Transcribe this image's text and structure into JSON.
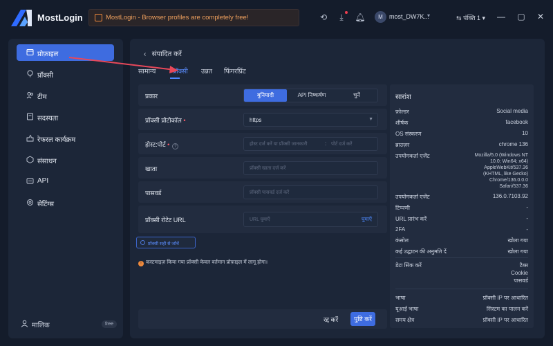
{
  "titlebar": {
    "app_name": "MostLogin",
    "banner_text": "MostLogin - Browser profiles are completely free!",
    "user_initial": "M",
    "user_name": "most_DW7K...",
    "language": "पंक्ति 1",
    "icons": [
      "refresh-icon",
      "download-icon",
      "bell-icon",
      "minimize-icon",
      "maximize-icon",
      "close-icon"
    ]
  },
  "sidebar": {
    "items": [
      {
        "label": "प्रोफ़ाइल",
        "icon": "profile-icon",
        "active": true
      },
      {
        "label": "प्रॉक्सी",
        "icon": "proxy-icon"
      },
      {
        "label": "टीम",
        "icon": "team-icon"
      },
      {
        "label": "सदस्यता",
        "icon": "subscription-icon"
      },
      {
        "label": "रेफरल कार्यक्रम",
        "icon": "referral-icon"
      },
      {
        "label": "संसाधन",
        "icon": "resources-icon"
      },
      {
        "label": "API",
        "icon": "api-icon"
      },
      {
        "label": "सेटिंग्स",
        "icon": "settings-icon"
      }
    ],
    "owner_label": "मालिक",
    "free_badge": "free"
  },
  "main": {
    "back_label": "संपादित करें",
    "tabs": [
      {
        "label": "सामान्य"
      },
      {
        "label": "प्रॉक्सी",
        "active": true
      },
      {
        "label": "उन्नत"
      },
      {
        "label": "फिंगरप्रिंट"
      }
    ],
    "form": {
      "type_label": "प्रकार",
      "type_options": [
        "बुनियादी",
        "API निष्कर्षण",
        "चुनें"
      ],
      "type_selected": "बुनियादी",
      "protocol_label": "प्रॉक्सी प्रोटोकॉल",
      "protocol_value": "https",
      "host_label": "होस्ट:पोर्ट",
      "host_placeholder": "होस्ट दर्ज करें या प्रॉक्सी जानकारी",
      "port_placeholder": "पोर्ट दर्ज करें",
      "account_label": "खाता",
      "account_placeholder": "प्रॉक्सी खाता दर्ज करें",
      "password_label": "पासवर्ड",
      "password_placeholder": "प्रॉक्सी पासवर्ड दर्ज करें",
      "rotate_label": "प्रॉक्सी रोटेट URL",
      "rotate_placeholder": "URL घुमाएँ",
      "rotate_link": "घुमाएँ",
      "check_button": "प्रॉक्सी सही से जाँचें",
      "note": "कस्टमाइज़ किया गया प्रॉक्सी केवल वर्तमान प्रोफ़ाइल में लागू होगा।"
    },
    "footer": {
      "cancel": "रद्द करें",
      "confirm": "पुष्टि करें"
    }
  },
  "summary": {
    "title": "सारांश",
    "rows": [
      {
        "k": "फ़ोल्डर",
        "v": "Social media"
      },
      {
        "k": "शीर्षक",
        "v": "facebook"
      },
      {
        "k": "OS संस्करण",
        "v": "10"
      },
      {
        "k": "ब्राउज़र",
        "v": "chrome  136"
      }
    ],
    "ua_label": "उपयोगकर्ता एजेंट",
    "ua_lines": [
      "Mozilla/5.0 (Windows NT",
      "10.0; Win64; x64)",
      "AppleWebKit/537.36",
      "(KHTML, like Gecko)",
      "Chrome/136.0.0.0",
      "Safari/537.36"
    ],
    "rows2": [
      {
        "k": "उपयोगकर्ता एजेंट",
        "v": "136.0.7103.92"
      },
      {
        "k": "टिप्पणी",
        "v": "-"
      },
      {
        "k": "URL प्रारंभ करें",
        "v": "-"
      },
      {
        "k": "2FA",
        "v": "-"
      },
      {
        "k": "कंसोल",
        "v": "खोला गया"
      },
      {
        "k": "कई उद्घाटन की अनुमति दें",
        "v": "खोला गया"
      }
    ],
    "sync_label": "डेटा सिंक करें",
    "sync_values": [
      "टैब्स",
      "Cookie",
      "पासवर्ड"
    ],
    "rows3": [
      {
        "k": "भाषा",
        "v": "प्रॉक्सी IP पर आधारित"
      },
      {
        "k": "यूआई भाषा",
        "v": "सिस्टम का पालन करें"
      },
      {
        "k": "समय क्षेत्र",
        "v": "प्रॉक्सी IP पर आधारित"
      }
    ]
  },
  "colors": {
    "accent": "#3e6ce0",
    "background": "#141c2b",
    "panel": "#1c2638",
    "annotation": "#e8485a"
  }
}
